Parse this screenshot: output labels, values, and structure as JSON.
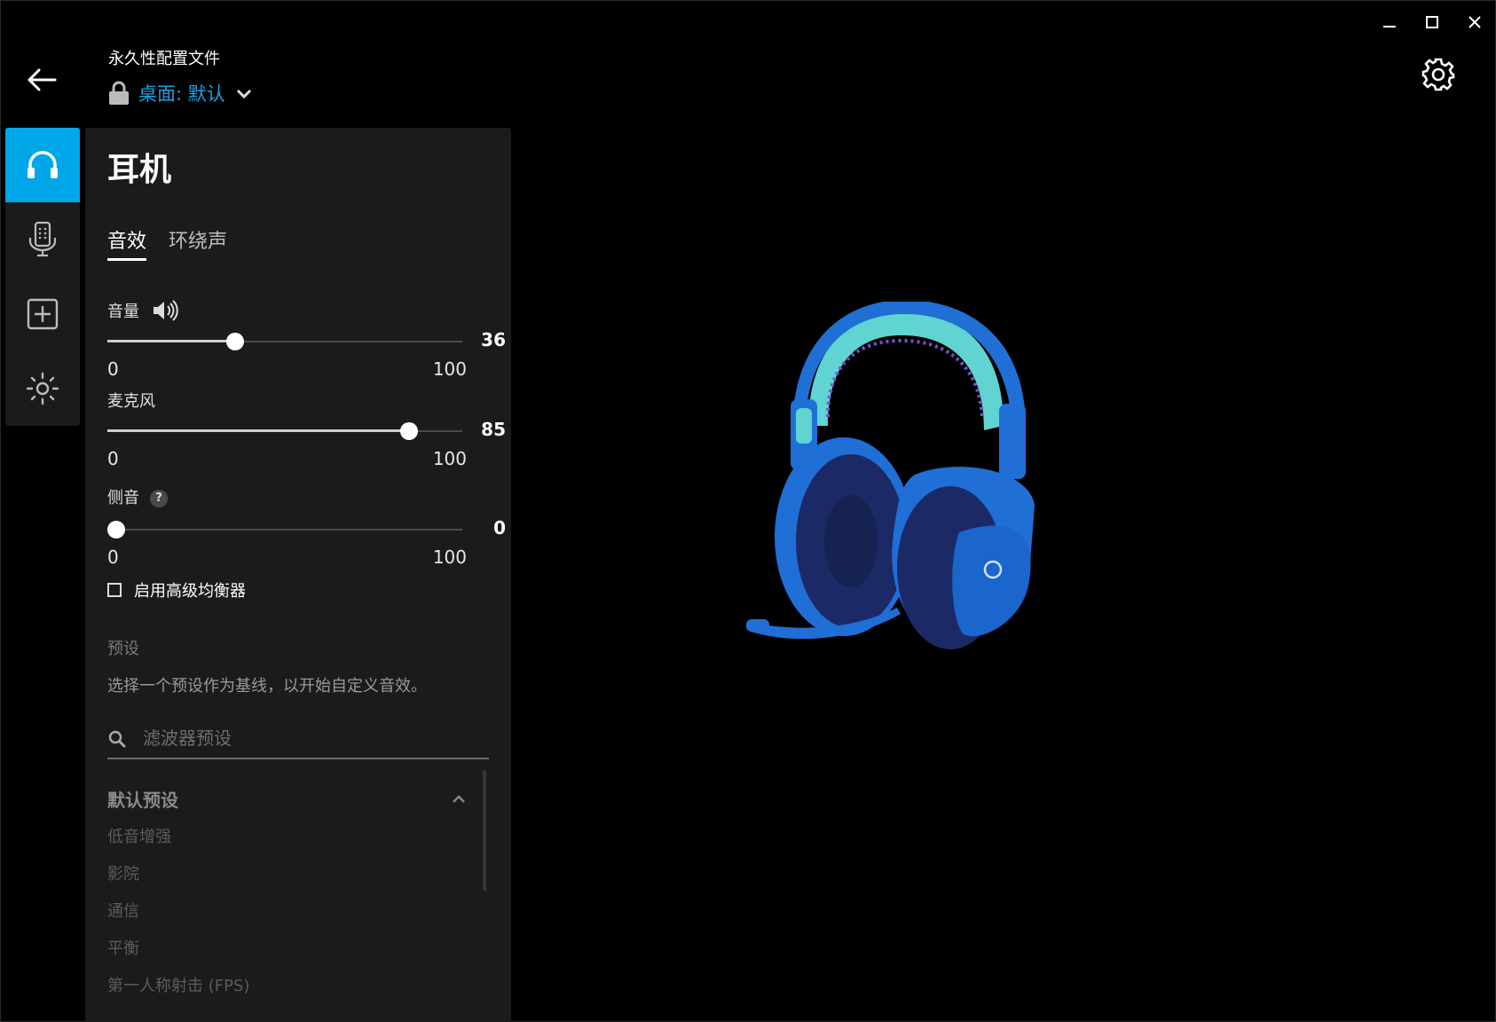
{
  "window": {
    "minimize_glyph": "—",
    "maximize_glyph": "☐",
    "close_glyph": "✕"
  },
  "header": {
    "profile_caption": "永久性配置文件",
    "profile_name": "桌面: 默认"
  },
  "rail": {
    "items": [
      {
        "icon": "headphones-icon",
        "active": true
      },
      {
        "icon": "microphone-icon",
        "active": false
      },
      {
        "icon": "add-icon",
        "active": false
      },
      {
        "icon": "lighting-icon",
        "active": false
      }
    ]
  },
  "panel": {
    "title": "耳机",
    "tabs": [
      {
        "label": "音效",
        "active": true
      },
      {
        "label": "环绕声",
        "active": false
      }
    ],
    "volume": {
      "label": "音量",
      "value": "36",
      "min": "0",
      "max": "100",
      "level": 36
    },
    "microphone": {
      "label": "麦克风",
      "value": "85",
      "min": "0",
      "max": "100",
      "level": 85
    },
    "sidetone": {
      "label": "侧音",
      "value": "0",
      "min": "0",
      "max": "100",
      "level": 0,
      "help": "?"
    },
    "advanced_eq": {
      "label": "启用高级均衡器",
      "checked": false
    },
    "presets": {
      "heading": "预设",
      "description": "选择一个预设作为基线，以开始自定义音效。",
      "search_placeholder": "滤波器预设",
      "group_title": "默认预设",
      "items": [
        "低音增强",
        "影院",
        "通信",
        "平衡",
        "第一人称射击 (FPS)"
      ]
    }
  },
  "colors": {
    "accent": "#00a7e8",
    "profile_text": "#1aa0e6",
    "headset_blue": "#1f6fd6"
  }
}
